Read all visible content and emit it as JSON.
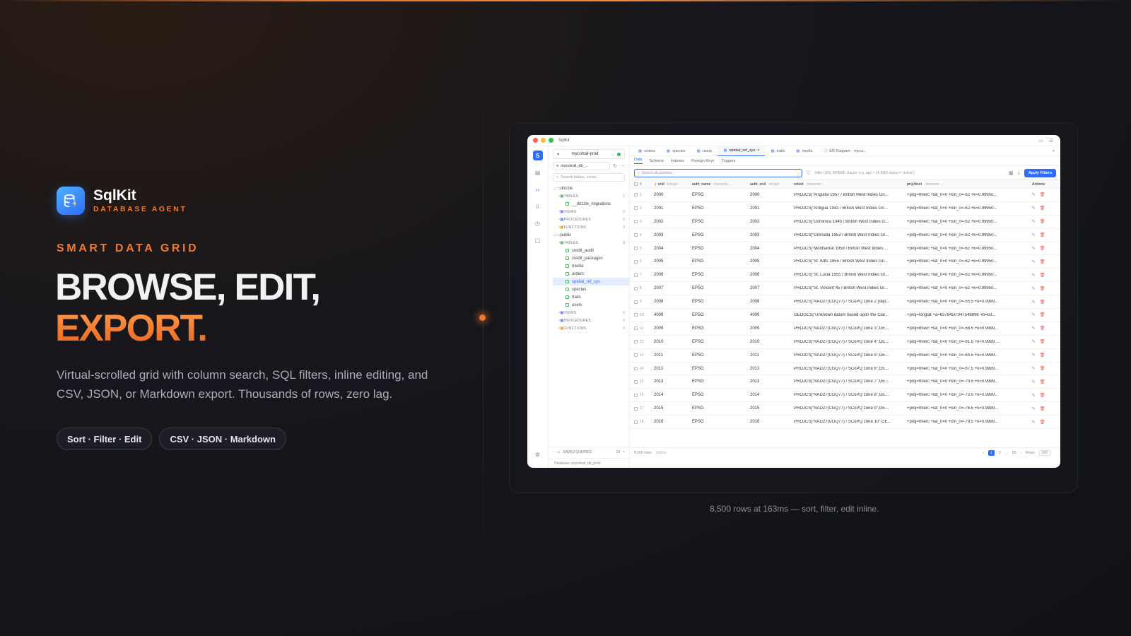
{
  "brand": {
    "name": "SqlKit",
    "subtitle": "DATABASE AGENT"
  },
  "eyebrow": "SMART DATA GRID",
  "headline": {
    "line1": "BROWSE, EDIT,",
    "line2": "EXPORT."
  },
  "description": "Virtual-scrolled grid with column search, SQL filters, inline editing, and CSV, JSON, or Markdown export. Thousands of rows, zero lag.",
  "pills": [
    "Sort · Filter · Edit",
    "CSV · JSON · Markdown"
  ],
  "caption": "8,500 rows at 163ms — sort, filter, edit inline.",
  "app": {
    "title": "SqlKit",
    "connection": "mycotrail-prod",
    "database": "mycotrail_db_...",
    "sidebar_search_placeholder": "Search tables, views...",
    "tree": [
      {
        "type": "schema",
        "label": "drizzle"
      },
      {
        "type": "cat",
        "label": "TABLES",
        "count": "1"
      },
      {
        "type": "table",
        "label": "__drizzle_migrations"
      },
      {
        "type": "cat",
        "label": "VIEWS",
        "count": "0"
      },
      {
        "type": "cat",
        "label": "PROCEDURES",
        "count": "0"
      },
      {
        "type": "cat",
        "label": "FUNCTIONS",
        "count": "0"
      },
      {
        "type": "schema",
        "label": "public"
      },
      {
        "type": "cat",
        "label": "TABLES",
        "count": "8"
      },
      {
        "type": "table",
        "label": "credit_audit"
      },
      {
        "type": "table",
        "label": "credit_packages"
      },
      {
        "type": "table",
        "label": "media"
      },
      {
        "type": "table",
        "label": "orders"
      },
      {
        "type": "table",
        "label": "spatial_ref_sys",
        "selected": true
      },
      {
        "type": "table",
        "label": "species"
      },
      {
        "type": "table",
        "label": "trails"
      },
      {
        "type": "table",
        "label": "users"
      },
      {
        "type": "cat",
        "label": "VIEWS",
        "count": "0"
      },
      {
        "type": "cat",
        "label": "PROCEDURES",
        "count": "0"
      },
      {
        "type": "cat",
        "label": "FUNCTIONS",
        "count": "0"
      }
    ],
    "saved_queries": {
      "label": "SAVED QUERIES",
      "count": "10"
    },
    "statusbar": "Database: mycotrail_db_prod",
    "tabs": [
      "orders",
      "species",
      "users",
      "spatial_ref_sys",
      "trails",
      "media",
      "ER Diagram - myco..."
    ],
    "active_tab": "spatial_ref_sys",
    "subtabs": [
      "Data",
      "Schema",
      "Indexes",
      "Foreign Keys",
      "Triggers"
    ],
    "search_placeholder": "Search all columns...",
    "filter_placeholder": "Filter (SQL WHERE clause, e.g. age > 18 AND status = 'active')",
    "apply_label": "Apply Filters",
    "columns": [
      {
        "name": "#",
        "type": ""
      },
      {
        "name": "srid",
        "type": "integer"
      },
      {
        "name": "auth_name",
        "type": "character ..."
      },
      {
        "name": "auth_srid",
        "type": "integer"
      },
      {
        "name": "srtext",
        "type": "character ..."
      },
      {
        "name": "proj4text",
        "type": "character ..."
      },
      {
        "name": "Actions",
        "type": ""
      }
    ],
    "rows": [
      [
        "1",
        "2000",
        "EPSG",
        "2000",
        "PROJCS[\"Anguilla 1957 / British West Indies Gri...",
        "+proj=tmerc +lat_0=0 +lon_0=-62 +k=0.99950..."
      ],
      [
        "2",
        "2001",
        "EPSG",
        "2001",
        "PROJCS[\"Antigua 1943 / British West Indies Gri...",
        "+proj=tmerc +lat_0=0 +lon_0=-62 +k=0.99950..."
      ],
      [
        "3",
        "2002",
        "EPSG",
        "2002",
        "PROJCS[\"Dominica 1945 / British West Indies G...",
        "+proj=tmerc +lat_0=0 +lon_0=-62 +k=0.99950..."
      ],
      [
        "4",
        "2003",
        "EPSG",
        "2003",
        "PROJCS[\"Grenada 1953 / British West Indies Gr...",
        "+proj=tmerc +lat_0=0 +lon_0=-62 +k=0.99950..."
      ],
      [
        "5",
        "2004",
        "EPSG",
        "2004",
        "PROJCS[\"Montserrat 1958 / British West Indies ...",
        "+proj=tmerc +lat_0=0 +lon_0=-62 +k=0.99950..."
      ],
      [
        "6",
        "2005",
        "EPSG",
        "2005",
        "PROJCS[\"St. Kitts 1955 / British West Indies Gri...",
        "+proj=tmerc +lat_0=0 +lon_0=-62 +k=0.99950..."
      ],
      [
        "7",
        "2006",
        "EPSG",
        "2006",
        "PROJCS[\"St. Lucia 1955 / British West Indies Gr...",
        "+proj=tmerc +lat_0=0 +lon_0=-62 +k=0.99950..."
      ],
      [
        "8",
        "2007",
        "EPSG",
        "2007",
        "PROJCS[\"St. Vincent 45 / British West Indies Gr...",
        "+proj=tmerc +lat_0=0 +lon_0=-62 +k=0.99950..."
      ],
      [
        "9",
        "2008",
        "EPSG",
        "2008",
        "PROJCS[\"NAD27(CGQ77) / SCoPQ zone 2 (dep...",
        "+proj=tmerc +lat_0=0 +lon_0=-55.5 +k=0.9999..."
      ],
      [
        "10",
        "4009",
        "EPSG",
        "4009",
        "GEOGCS[\"Unknown datum based upon the Clar...",
        "+proj=longlat +a=6378450.047548896 +b=63..."
      ],
      [
        "11",
        "2009",
        "EPSG",
        "2009",
        "PROJCS[\"NAD27(CGQ77) / SCoPQ zone 3\",GE...",
        "+proj=tmerc +lat_0=0 +lon_0=-58.5 +k=0.9999..."
      ],
      [
        "12",
        "2010",
        "EPSG",
        "2010",
        "PROJCS[\"NAD27(CGQ77) / SCoPQ zone 4\",GE...",
        "+proj=tmerc +lat_0=0 +lon_0=-61.5 +k=0.9999 ..."
      ],
      [
        "13",
        "2011",
        "EPSG",
        "2011",
        "PROJCS[\"NAD27(CGQ77) / SCoPQ zone 5\",GE...",
        "+proj=tmerc +lat_0=0 +lon_0=-64.5 +k=0.9999..."
      ],
      [
        "14",
        "2012",
        "EPSG",
        "2012",
        "PROJCS[\"NAD27(CGQ77) / SCoPQ zone 6\",GE...",
        "+proj=tmerc +lat_0=0 +lon_0=-67.5 +k=0.9999..."
      ],
      [
        "15",
        "2013",
        "EPSG",
        "2013",
        "PROJCS[\"NAD27(CGQ77) / SCoPQ zone 7\",GE...",
        "+proj=tmerc +lat_0=0 +lon_0=-70.5 +k=0.9999..."
      ],
      [
        "16",
        "2014",
        "EPSG",
        "2014",
        "PROJCS[\"NAD27(CGQ77) / SCoPQ zone 8\",GE...",
        "+proj=tmerc +lat_0=0 +lon_0=-73.5 +k=0.9999..."
      ],
      [
        "17",
        "2015",
        "EPSG",
        "2015",
        "PROJCS[\"NAD27(CGQ77) / SCoPQ zone 9\",GE...",
        "+proj=tmerc +lat_0=0 +lon_0=-76.5 +k=0.9999..."
      ],
      [
        "18",
        "2016",
        "EPSG",
        "2016",
        "PROJCS[\"NAD27(CGQ77) / SCoPQ zone 10\",GE...",
        "+proj=tmerc +lat_0=0 +lon_0=-79.5 +k=0.9999..."
      ]
    ],
    "pager": {
      "rows": "8,500 rows",
      "time": "163ms",
      "pages": [
        "1",
        "2",
        "...",
        "85"
      ],
      "rows_label": "Rows",
      "page_size": "100"
    }
  },
  "colors": {
    "accent": "#f07a2a",
    "blue": "#2f6bff"
  }
}
